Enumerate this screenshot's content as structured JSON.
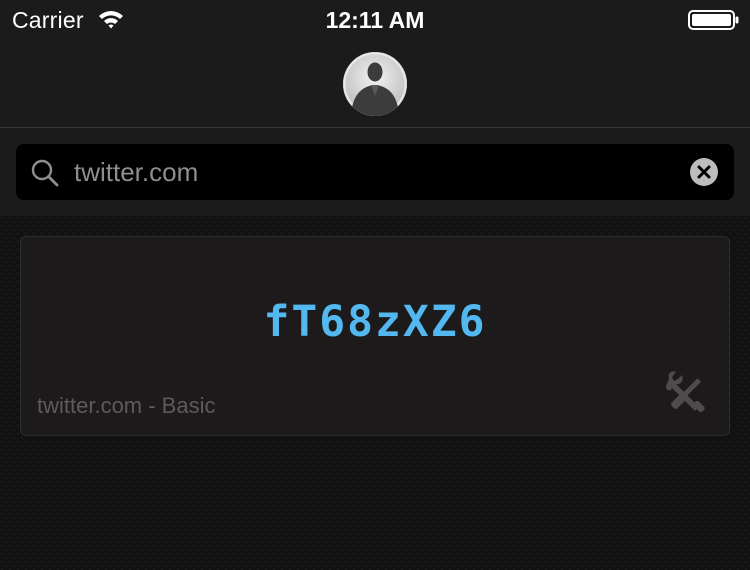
{
  "status_bar": {
    "carrier": "Carrier",
    "time": "12:11 AM",
    "wifi_icon": "wifi-icon",
    "battery_icon": "battery-icon"
  },
  "nav_bar": {
    "avatar_icon": "user-silhouette-icon"
  },
  "search": {
    "value": "twitter.com",
    "search_icon": "magnifier-icon",
    "clear_icon": "clear-x-icon"
  },
  "password_card": {
    "password": "fT68zXZ6",
    "site_label": "twitter.com - Basic",
    "settings_icon": "wrench-screwdriver-icon"
  },
  "colors": {
    "password_text": "#53b8f0",
    "bar_background": "#1b1b1b",
    "card_background": "#1c1a1b",
    "muted_text": "#5c5a5b"
  }
}
